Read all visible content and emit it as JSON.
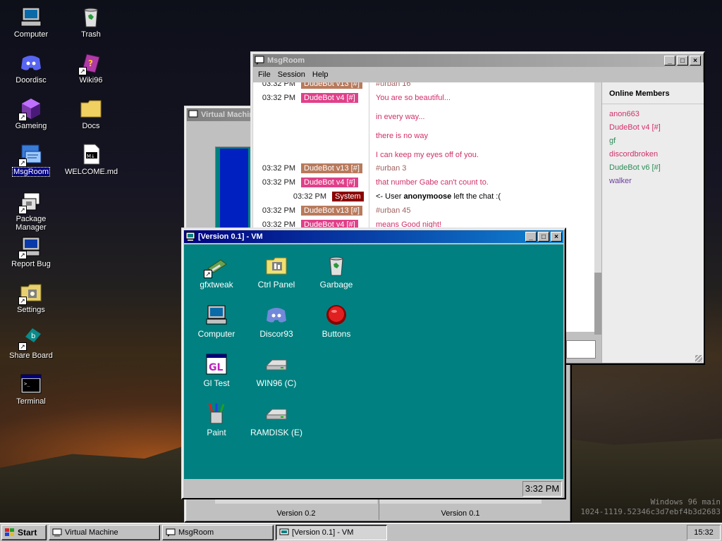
{
  "desktop": {
    "icons": [
      {
        "label": "Computer",
        "icon": "computer-icon"
      },
      {
        "label": "Trash",
        "icon": "recycle-bin-icon"
      },
      {
        "label": "Doordisc",
        "icon": "discord-icon"
      },
      {
        "label": "Wiki96",
        "icon": "book-icon"
      },
      {
        "label": "Gameing",
        "icon": "cube-icon"
      },
      {
        "label": "Docs",
        "icon": "folder-icon"
      },
      {
        "label": "MsgRoom",
        "icon": "chat-icon"
      },
      {
        "label": "WELCOME.md",
        "icon": "markdown-file-icon"
      },
      {
        "label": "Package Manager",
        "icon": "package-icon"
      },
      {
        "label": "Report Bug",
        "icon": "bug-report-icon"
      },
      {
        "label": "Settings",
        "icon": "settings-icon"
      },
      {
        "label": "Share Board",
        "icon": "share-board-icon"
      },
      {
        "label": "Terminal",
        "icon": "terminal-icon"
      }
    ],
    "watermark_line1": "Windows 96 main",
    "watermark_line2": "1024-1119.52346c3d7ebf4b3d2683"
  },
  "msgroom": {
    "title": "MsgRoom",
    "menu": [
      "File",
      "Session",
      "Help"
    ],
    "members_title": "Online Members",
    "members": [
      {
        "name": "anon663",
        "color": "#d0306a"
      },
      {
        "name": "DudeBot v4 [#]",
        "color": "#d0306a"
      },
      {
        "name": "gf",
        "color": "#2e8b57"
      },
      {
        "name": "discordbroken",
        "color": "#d0306a"
      },
      {
        "name": "DudeBot v6 [#]",
        "color": "#2e8b57"
      },
      {
        "name": "walker",
        "color": "#6a3d9a"
      }
    ],
    "messages": [
      {
        "time": "03:32 PM",
        "user": "DudeBot v13 [#]",
        "user_color": "#b87a5c",
        "text": "#urban 16",
        "text_color": "#a06060"
      },
      {
        "time": "03:32 PM",
        "user": "DudeBot v4 [#]",
        "user_color": "#e0408a",
        "text": "You are so beautiful...",
        "text_color": "#d0306a"
      },
      {
        "time": "",
        "user": "",
        "user_color": "",
        "text": "in every way...",
        "text_color": "#d0306a"
      },
      {
        "time": "",
        "user": "",
        "user_color": "",
        "text": "there is no way",
        "text_color": "#d0306a"
      },
      {
        "time": "",
        "user": "",
        "user_color": "",
        "text": "I can keep my eyes off of you.",
        "text_color": "#d0306a"
      },
      {
        "time": "03:32 PM",
        "user": "DudeBot v13 [#]",
        "user_color": "#b87a5c",
        "text": "#urban 3",
        "text_color": "#a06060"
      },
      {
        "time": "03:32 PM",
        "user": "DudeBot v4 [#]",
        "user_color": "#e0408a",
        "text": "that number Gabe can't count to.",
        "text_color": "#d0306a"
      },
      {
        "time": "03:32 PM",
        "user": "System",
        "user_color": "#8b0000",
        "text_prefix": "<- User ",
        "text_bold": "anonymoose",
        "text_suffix": " left the chat :(",
        "text_color": "#000000"
      },
      {
        "time": "03:32 PM",
        "user": "DudeBot v13 [#]",
        "user_color": "#b87a5c",
        "text": "#urban 45",
        "text_color": "#a06060"
      },
      {
        "time": "03:32 PM",
        "user": "DudeBot v4 [#]",
        "user_color": "#e0408a",
        "text": "means Good night!",
        "text_color": "#d0306a"
      }
    ]
  },
  "virtual_machine": {
    "title": "Virtual Machine",
    "tab_labels": [
      "Version 0.2",
      "Version 0.1"
    ]
  },
  "vm": {
    "title": "[Version 0.1] - VM",
    "clock": "3:32 PM",
    "icons": [
      {
        "label": "gfxtweak",
        "icon": "gfxtweak-icon"
      },
      {
        "label": "Ctrl Panel",
        "icon": "control-panel-icon"
      },
      {
        "label": "Garbage",
        "icon": "recycle-bin-icon"
      },
      {
        "label": "Computer",
        "icon": "computer-icon"
      },
      {
        "label": "Discor93",
        "icon": "discord-icon"
      },
      {
        "label": "Buttons",
        "icon": "red-button-icon"
      },
      {
        "label": "Gl Test",
        "icon": "gl-test-icon"
      },
      {
        "label": "WIN96 (C)",
        "icon": "drive-icon"
      },
      {
        "label": "Paint",
        "icon": "paint-icon"
      },
      {
        "label": "RAMDISK (E)",
        "icon": "drive-icon"
      }
    ]
  },
  "taskbar": {
    "start_label": "Start",
    "items": [
      {
        "label": "Virtual Machine"
      },
      {
        "label": "MsgRoom"
      },
      {
        "label": "[Version 0.1] - VM"
      }
    ],
    "clock": "15:32"
  }
}
